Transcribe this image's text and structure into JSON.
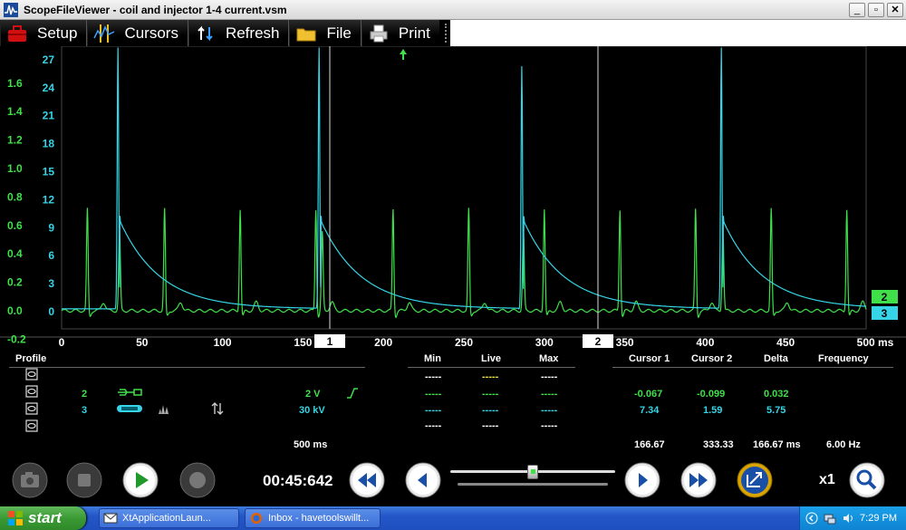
{
  "window": {
    "title": "ScopeFileViewer - coil and injector 1-4 current.vsm"
  },
  "toolbar": {
    "setup": "Setup",
    "cursors": "Cursors",
    "refresh": "Refresh",
    "file": "File",
    "print": "Print"
  },
  "chart_data": {
    "type": "line",
    "x_ticks": [
      "0",
      "50",
      "100",
      "150",
      "200",
      "250",
      "300",
      "350",
      "400",
      "450",
      "500 ms"
    ],
    "x_tick_values": [
      0,
      50,
      100,
      150,
      200,
      250,
      300,
      350,
      400,
      450,
      500
    ],
    "xlim": [
      0,
      500
    ],
    "y_left_ticks": [
      "1.6",
      "1.4",
      "1.2",
      "1.0",
      "0.8",
      "0.6",
      "0.4",
      "0.2",
      "0.0",
      "-0.2"
    ],
    "y_right_ticks": [
      "27",
      "24",
      "21",
      "18",
      "15",
      "12",
      "9",
      "6",
      "3",
      "0"
    ],
    "cursor_labels": [
      "1",
      "2"
    ],
    "cursor_positions_ms": [
      166.67,
      333.33
    ],
    "channel_markers": [
      "2",
      "3"
    ],
    "series": [
      {
        "channel": "2",
        "color": "#3fe04a",
        "baseline": 0.0,
        "spikes_ms": [
          16,
          64,
          111,
          158,
          206,
          253,
          300,
          347,
          394,
          441,
          488
        ],
        "spike_height": 0.72,
        "ignition_ms": [
          36,
          162,
          287,
          411
        ]
      },
      {
        "channel": "3",
        "color": "#35d4e6",
        "baseline": 0.0,
        "spikes_ms": [
          35,
          160,
          286,
          410
        ],
        "spike_heights_kv": [
          28,
          28,
          26,
          28
        ],
        "decay_start_kv": 9.5
      }
    ]
  },
  "info": {
    "profile_label": "Profile",
    "col_min": "Min",
    "col_live": "Live",
    "col_max": "Max",
    "col_cursor1": "Cursor 1",
    "col_cursor2": "Cursor 2",
    "col_delta": "Delta",
    "col_frequency": "Frequency",
    "dashes": "-----",
    "ch2": {
      "name": "2",
      "scale": "2 V",
      "cursor1": "-0.067",
      "cursor2": "-0.099",
      "delta": "0.032"
    },
    "ch3": {
      "name": "3",
      "scale": "30 kV",
      "cursor1": "7.34",
      "cursor2": "1.59",
      "delta": "5.75"
    },
    "timebase": "500 ms",
    "time_cursor1": "166.67",
    "time_cursor2": "333.33",
    "time_delta": "166.67 ms",
    "time_frequency": "6.00 Hz"
  },
  "controls": {
    "time": "00:45:642",
    "zoom": "x1",
    "slider_value": 0.5
  },
  "taskbar": {
    "start": "start",
    "task1": "XtApplicationLaun...",
    "task2": "Inbox - havetoolswillt...",
    "clock": "7:29 PM"
  }
}
